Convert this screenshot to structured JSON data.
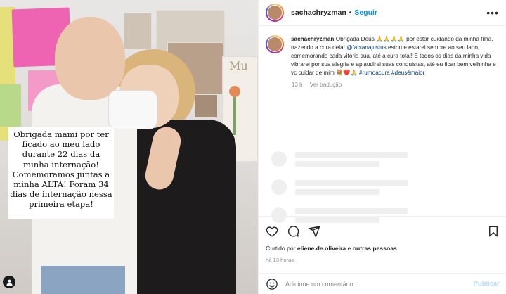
{
  "media": {
    "overlay_text": "Obrigada mami por ter ficado ao meu lado durante 22 dias da minha internação! Comemoramos juntas a minha ALTA! Foram 34 dias de internação nessa primeira etapa!",
    "wall_text": "Mu"
  },
  "post": {
    "username": "sachachryzman",
    "follow_label": "Seguir",
    "more_label": "•••",
    "caption": {
      "username": "sachachryzman",
      "text_1": " Obrigada Deus 🙏🙏🙏🙏 por estar cuidando da minha filha, trazendo a cura dela! ",
      "mention": "@fabianajustus",
      "text_2": " estou e estarei sempre ao seu lado, comemorando cada vitória sua, até a cura total! E todos os dias da minha vida vibrarei por sua alegria e aplaudirei suas conquistas, até eu ficar bem velhinha e vc cuidar de mim 💐❤️🙏 ",
      "hashtag_1": "#rumoacura",
      "hashtag_2": "#deusémaior"
    },
    "meta": {
      "time": "13 h",
      "translate_label": "Ver tradução"
    },
    "likes": {
      "prefix": "Curtido por ",
      "user": "eliene.de.oliveira",
      "joiner": " e ",
      "others": "outras pessoas"
    },
    "posted_ago": "há 13 horas",
    "comment_placeholder": "Adicione um comentário...",
    "publish_label": "Publicar"
  },
  "colors": {
    "link_blue": "#0095f6",
    "mention_blue": "#00376b",
    "muted": "#8e8e8e",
    "publish_disabled": "#b2dffc"
  },
  "icons": [
    "heart-icon",
    "comment-icon",
    "share-icon",
    "bookmark-icon",
    "emoji-icon",
    "camera-icon"
  ]
}
